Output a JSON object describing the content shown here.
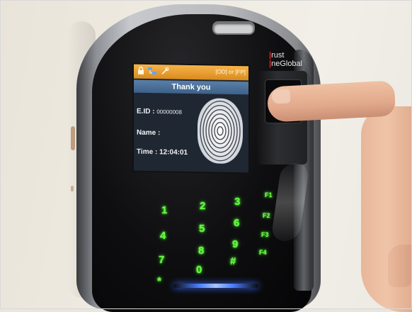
{
  "device": {
    "brand_line1": "rust",
    "brand_line2": "neGlobal",
    "brand_accent": "#d22222"
  },
  "screen": {
    "status_icons": [
      "lock-icon",
      "network-icon",
      "tools-icon"
    ],
    "status_right": "[OD] or [FP]",
    "title": "Thank you",
    "eid_label": "E.ID :",
    "eid_value": "00000008",
    "name_label": "Name :",
    "time_label": "Time :",
    "time_value": "12:04:01"
  },
  "keypad": {
    "keys": [
      "1",
      "2",
      "3",
      "4",
      "5",
      "6",
      "7",
      "8",
      "9",
      "*",
      "0",
      "#"
    ],
    "function_keys": [
      "F1",
      "F2",
      "F3",
      "F4"
    ],
    "glow_color": "#5fff3c"
  },
  "led_color": "#4a7dff"
}
